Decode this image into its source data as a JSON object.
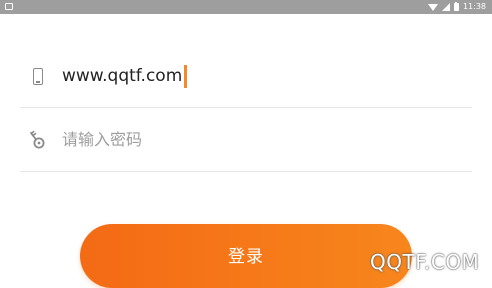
{
  "status_bar": {
    "time": "11:38",
    "icons": [
      "notification-icon",
      "wifi-icon",
      "signal-icon",
      "battery-icon"
    ]
  },
  "form": {
    "account": {
      "icon": "phone-icon",
      "value": "www.qqtf.com"
    },
    "password": {
      "icon": "key-icon",
      "placeholder": "请输入密码"
    },
    "login_button_label": "登录"
  },
  "watermark": "QQTF.COM",
  "colors": {
    "accent_start": "#f46a15",
    "accent_end": "#f7861c",
    "cursor": "#f08a2a",
    "status_bar": "#9e9e9e"
  }
}
